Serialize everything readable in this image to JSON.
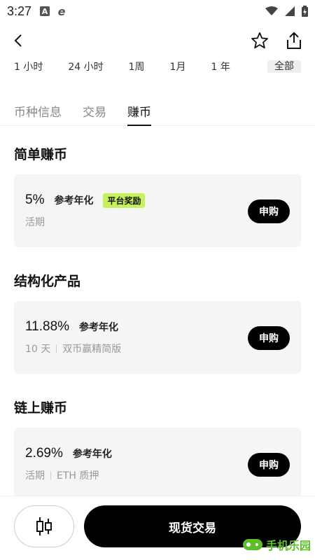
{
  "status_bar": {
    "time": "3:27",
    "icons": [
      "notification-a-icon",
      "browser-e-icon",
      "wifi-icon",
      "signal-icon",
      "battery-icon"
    ]
  },
  "nav": {
    "back_icon": "chevron-left-icon",
    "favorite_icon": "star-icon",
    "share_icon": "share-icon"
  },
  "time_range": [
    "1 小时",
    "24 小时",
    "1周",
    "1月",
    "1 年",
    "全部"
  ],
  "tabs": [
    {
      "label": "币种信息",
      "active": false
    },
    {
      "label": "交易",
      "active": false
    },
    {
      "label": "赚币",
      "active": true
    }
  ],
  "sections": [
    {
      "title": "简单赚币",
      "rate": "5%",
      "ref_label": "参考年化",
      "tag": "平台奖励",
      "term": "活期",
      "extra": "",
      "button": "申购"
    },
    {
      "title": "结构化产品",
      "rate": "11.88%",
      "ref_label": "参考年化",
      "tag": "",
      "term": "10 天",
      "extra": "双币赢精简版",
      "button": "申购"
    },
    {
      "title": "链上赚币",
      "rate": "2.69%",
      "ref_label": "参考年化",
      "tag": "",
      "term": "活期",
      "extra": "ETH 质押",
      "button": "申购"
    }
  ],
  "bottom": {
    "chart_icon": "candlestick-icon",
    "trade_label": "现货交易"
  },
  "watermark": {
    "text": "手机乐园"
  },
  "colors": {
    "accent_tag": "#c7f15a",
    "button_bg": "#000000",
    "card_bg": "#f5f5f5",
    "watermark": "#5cbf2a"
  }
}
